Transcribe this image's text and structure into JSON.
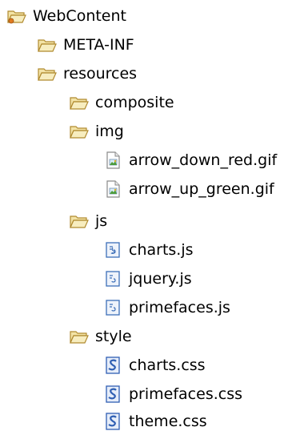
{
  "tree": {
    "root": {
      "label": "WebContent",
      "icon": "project-folder-icon"
    },
    "meta_inf": {
      "label": "META-INF",
      "icon": "folder-icon"
    },
    "resources": {
      "label": "resources",
      "icon": "folder-icon"
    },
    "composite": {
      "label": "composite",
      "icon": "folder-icon"
    },
    "img": {
      "label": "img",
      "icon": "folder-icon"
    },
    "arrow_down_red": {
      "label": "arrow_down_red.gif",
      "icon": "image-file-icon"
    },
    "arrow_up_green": {
      "label": "arrow_up_green.gif",
      "icon": "image-file-icon"
    },
    "js": {
      "label": "js",
      "icon": "folder-icon"
    },
    "charts_js": {
      "label": "charts.js",
      "icon": "js-file-icon"
    },
    "jquery_js": {
      "label": "jquery.js",
      "icon": "js-file-icon"
    },
    "primefaces_js": {
      "label": "primefaces.js",
      "icon": "js-file-icon"
    },
    "style": {
      "label": "style",
      "icon": "folder-icon"
    },
    "charts_css": {
      "label": "charts.css",
      "icon": "css-file-icon"
    },
    "primefaces_css": {
      "label": "primefaces.css",
      "icon": "css-file-icon"
    },
    "theme_css": {
      "label": "theme.css",
      "icon": "css-file-icon"
    }
  },
  "colors": {
    "folder_fill": "#f3e3a6",
    "folder_stroke": "#b08a2f",
    "css_icon_blue": "#2f5fb3",
    "js_icon_blue": "#3d6fb8",
    "image_icon_accent": "#4b9b3a"
  }
}
